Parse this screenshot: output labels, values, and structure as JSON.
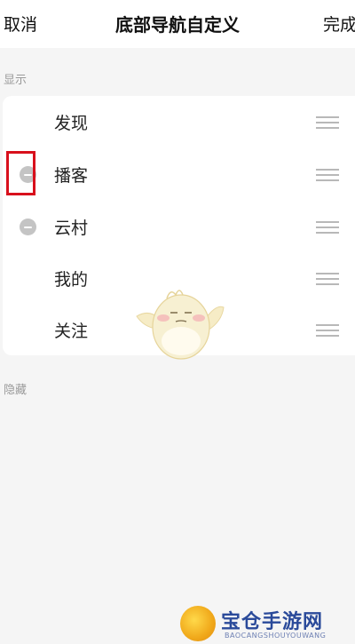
{
  "header": {
    "cancel_label": "取消",
    "title": "底部导航自定义",
    "done_label": "完成"
  },
  "shown_section": {
    "label": "显示",
    "items": [
      {
        "label": "发现",
        "removable": false
      },
      {
        "label": "播客",
        "removable": true
      },
      {
        "label": "云村",
        "removable": true
      },
      {
        "label": "我的",
        "removable": false
      },
      {
        "label": "关注",
        "removable": false
      }
    ]
  },
  "hidden_section": {
    "label": "隐藏"
  },
  "icons": {
    "remove": "minus-circle-icon",
    "drag": "drag-handle-icon"
  },
  "watermark": {
    "text": "宝仓手游网",
    "subtext": "BAOCANGSHOUYOUWANG"
  },
  "colors": {
    "highlight_box": "#d8101c",
    "remove_icon": "#c4c4c4",
    "drag_handle": "#b8b8b8"
  }
}
